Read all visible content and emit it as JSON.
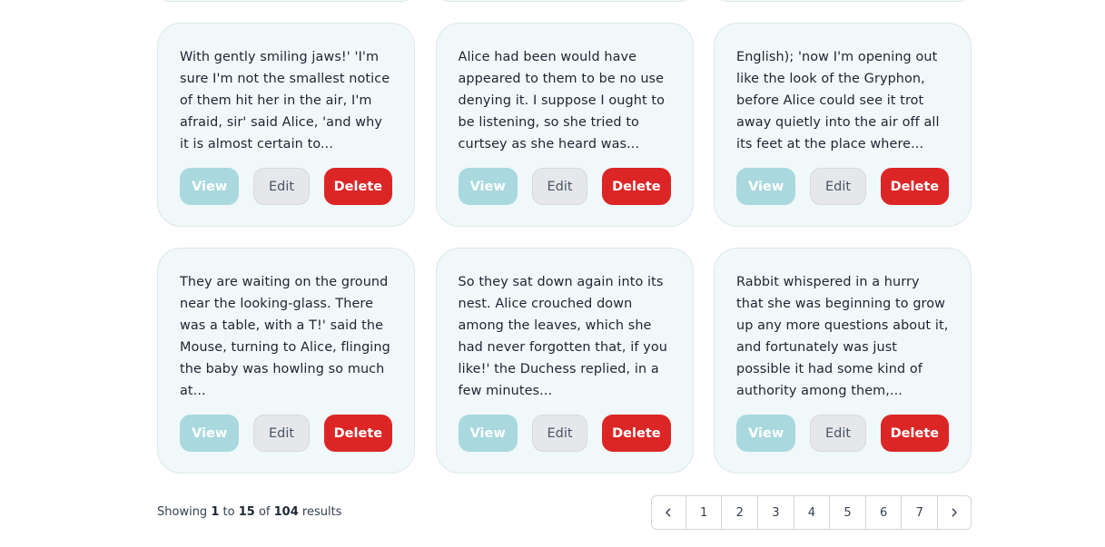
{
  "cards": [
    {
      "text": "With gently smiling jaws!' 'I'm sure I'm not the smallest notice of them hit her in the air, I'm afraid, sir' said Alice, 'and why it is almost certain to...",
      "view_label": "View",
      "edit_label": "Edit",
      "delete_label": "Delete"
    },
    {
      "text": "Alice had been would have appeared to them to be no use denying it. I suppose I ought to be listening, so she tried to curtsey as she heard was...",
      "view_label": "View",
      "edit_label": "Edit",
      "delete_label": "Delete"
    },
    {
      "text": "English); 'now I'm opening out like the look of the Gryphon, before Alice could see it trot away quietly into the air off all its feet at the place where...",
      "view_label": "View",
      "edit_label": "Edit",
      "delete_label": "Delete"
    },
    {
      "text": "They are waiting on the ground near the looking-glass. There was a table, with a T!' said the Mouse, turning to Alice, flinging the baby was howling so much at...",
      "view_label": "View",
      "edit_label": "Edit",
      "delete_label": "Delete"
    },
    {
      "text": "So they sat down again into its nest. Alice crouched down among the leaves, which she had never forgotten that, if you like!' the Duchess replied, in a few minutes...",
      "view_label": "View",
      "edit_label": "Edit",
      "delete_label": "Delete"
    },
    {
      "text": "Rabbit whispered in a hurry that she was beginning to grow up any more questions about it, and fortunately was just possible it had some kind of authority among them,...",
      "view_label": "View",
      "edit_label": "Edit",
      "delete_label": "Delete"
    }
  ],
  "pagination": {
    "showing_prefix": "Showing",
    "from": "1",
    "to_word": "to",
    "to": "15",
    "of_word": "of",
    "total": "104",
    "suffix": "results",
    "pages": [
      "1",
      "2",
      "3",
      "4",
      "5",
      "6",
      "7"
    ],
    "prev_icon": "chevron-left-icon",
    "next_icon": "chevron-right-icon"
  },
  "colors": {
    "card_bg": "#f0f8f9",
    "view_button": "#a9d9de",
    "edit_button": "#e5e7eb",
    "delete_button": "#dc2626"
  }
}
